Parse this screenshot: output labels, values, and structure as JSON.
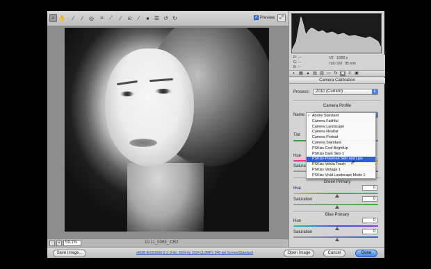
{
  "toolbar": {
    "tools": [
      "zoom-tool",
      "hand-tool",
      "white-balance-tool",
      "color-sampler-tool",
      "targeted-adjustment-tool",
      "crop-tool",
      "straighten-tool",
      "spot-removal-tool",
      "red-eye-tool",
      "adjustment-brush-tool",
      "graduated-filter-tool",
      "preferences-tool",
      "rotate-left-tool",
      "rotate-right-tool"
    ],
    "preview_label": "Preview",
    "preview_checked": true
  },
  "canvas": {
    "zoom_value": "59.1%",
    "filename": "10-11_0093_.CR2"
  },
  "readout": {
    "r": "R:   ---",
    "g": "G:   ---",
    "b": "B:   ---",
    "aperture": "f/2",
    "shutter": "1/200 s",
    "iso": "ISO 320",
    "focal": "85 mm"
  },
  "panel": {
    "title": "Camera Calibration",
    "process_label": "Process:",
    "process_value": "2010 (Current)",
    "camera_profile_title": "Camera Profile",
    "name_label": "Name",
    "tint_label": "Tint",
    "hue_label": "Hue",
    "saturation_label": "Saturation",
    "green_primary_title": "Green Primary",
    "green_hue_value": "0",
    "green_sat_value": "0",
    "blue_primary_title": "Blue Primary",
    "blue_hue_value": "0",
    "blue_sat_value": "0"
  },
  "profile_menu": {
    "options": [
      "Adobe Standard",
      "Camera Faithful",
      "Camera Landscape",
      "Camera Neutral",
      "Camera Portrait",
      "Camera Standard",
      "PSKiss Cool BrightUp",
      "PSKiss Dark Skin 1",
      "PSKiss Powered Skin and Lips",
      "PSKiss Velvia Touch",
      "PSKiss Vintage 1",
      "PSKiss Vivid Landscape Mode 1"
    ],
    "checked_index": 0,
    "highlighted_index": 8
  },
  "footer": {
    "save_label": "Save Image...",
    "workflow_link": "sRGB IEC61966-2.1; 8 bit; 1024 by 1024 (1.0MP); 240 ppi Screen/Standard",
    "open_label": "Open Image",
    "cancel_label": "Cancel",
    "done_label": "Done"
  },
  "colors": {
    "accent": "#3f84e0",
    "highlight": "#2f5fd0",
    "panel_bg": "#d4d4d4",
    "canvas_bg": "#8d8d8d"
  }
}
